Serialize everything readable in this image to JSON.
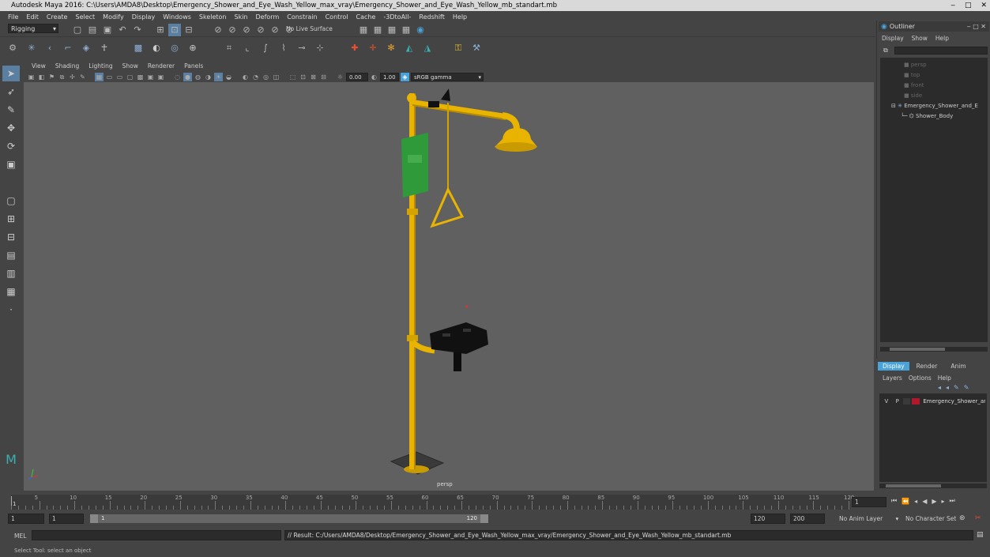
{
  "window": {
    "title": "Autodesk Maya 2016: C:\\Users\\AMDA8\\Desktop\\Emergency_Shower_and_Eye_Wash_Yellow_max_vray\\Emergency_Shower_and_Eye_Wash_Yellow_mb_standart.mb",
    "controls": [
      "‒",
      "□",
      "✕"
    ]
  },
  "menubar": [
    "File",
    "Edit",
    "Create",
    "Select",
    "Modify",
    "Display",
    "Windows",
    "Skeleton",
    "Skin",
    "Deform",
    "Constrain",
    "Control",
    "Cache",
    "-3DtoAll-",
    "Redshift",
    "Help"
  ],
  "statusline": {
    "mode": "Rigging",
    "live_surface": "No Live Surface"
  },
  "viewport": {
    "menu": [
      "View",
      "Shading",
      "Lighting",
      "Show",
      "Renderer",
      "Panels"
    ],
    "near_value": "0.00",
    "far_value": "1.00",
    "color_space": "sRGB gamma",
    "camera_label": "persp"
  },
  "outliner": {
    "title": "Outliner",
    "menu": [
      "Display",
      "Show",
      "Help"
    ],
    "items": [
      {
        "label": "persp",
        "dim": true
      },
      {
        "label": "top",
        "dim": true
      },
      {
        "label": "front",
        "dim": true
      },
      {
        "label": "side",
        "dim": true
      },
      {
        "label": "Emergency_Shower_and_E",
        "dim": false
      },
      {
        "label": "Shower_Body",
        "dim": false
      }
    ]
  },
  "layers": {
    "tabs": [
      "Display",
      "Render",
      "Anim"
    ],
    "menu": [
      "Layers",
      "Options",
      "Help"
    ],
    "row": {
      "v": "V",
      "p": "P",
      "name": "Emergency_Shower_ar",
      "color": "#b0182c"
    }
  },
  "timeline": {
    "ticks": [
      "5",
      "10",
      "15",
      "20",
      "25",
      "30",
      "35",
      "40",
      "45",
      "50",
      "55",
      "60",
      "65",
      "70",
      "75",
      "80",
      "85",
      "90",
      "95",
      "100",
      "105",
      "110",
      "115",
      "120"
    ],
    "start_label": "1",
    "current_frame": "1"
  },
  "range": {
    "start": "1",
    "start2": "1",
    "slider_start": "1",
    "slider_end": "120",
    "end": "120",
    "max_end": "200",
    "anim_layer": "No Anim Layer",
    "character_set": "No Character Set"
  },
  "cmdline": {
    "label": "MEL",
    "result": "// Result: C:/Users/AMDA8/Desktop/Emergency_Shower_and_Eye_Wash_Yellow_max_vray/Emergency_Shower_and_Eye_Wash_Yellow_mb_standart.mb"
  },
  "helpline": "Select Tool: select an object",
  "colors": {
    "accent": "#4aa3d8",
    "pipe_yellow": "#e8b400",
    "sign_green": "#2f9a3a"
  }
}
